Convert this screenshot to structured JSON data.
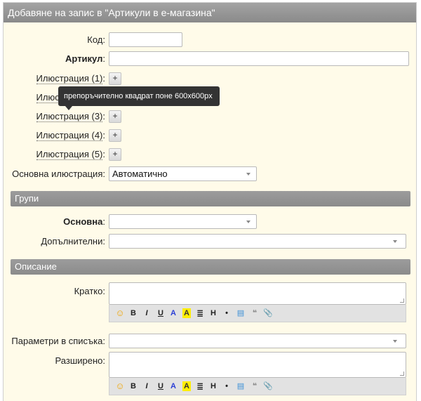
{
  "dialog": {
    "title": "Добавяне на запис в \"Артикули в е-магазина\""
  },
  "fields": {
    "code": {
      "label": "Код",
      "value": ""
    },
    "article": {
      "label": "Артикул",
      "value": ""
    },
    "illustrations": [
      {
        "label": "Илюстрация (1)",
        "button": "+"
      },
      {
        "label": "Илюстрация (2)",
        "button": "+"
      },
      {
        "label": "Илюстрация (3)",
        "button": "+"
      },
      {
        "label": "Илюстрация (4)",
        "button": "+"
      },
      {
        "label": "Илюстрация (5)",
        "button": "+"
      }
    ],
    "main_illustration": {
      "label": "Основна илюстрация",
      "value": "Автоматично"
    }
  },
  "tooltip": {
    "text": "препоръчително квадрат поне 600x600px"
  },
  "groups": {
    "title": "Групи",
    "main": {
      "label": "Основна",
      "value": ""
    },
    "additional": {
      "label": "Допълнителни",
      "value": ""
    }
  },
  "description": {
    "title": "Описание",
    "short": {
      "label": "Кратко"
    },
    "list_params": {
      "label": "Параметри в списъка",
      "value": ""
    },
    "extended": {
      "label": "Разширено"
    }
  },
  "toolbar": {
    "smiley": "☺",
    "bold": "B",
    "italic": "I",
    "underline": "U",
    "text_color": "A",
    "highlight": "A",
    "align": "≣",
    "heading": "H",
    "bullet": "•",
    "table": "▤",
    "quote": "❝",
    "attach": "📎"
  },
  "colors": {
    "background": "#fffbe9",
    "titlebar": "#939393",
    "text_color_blue": "#2b3fd6",
    "highlight_yellow": "#ffee00",
    "smiley": "#f0a400"
  },
  "punctuation": {
    "colon": ":"
  }
}
